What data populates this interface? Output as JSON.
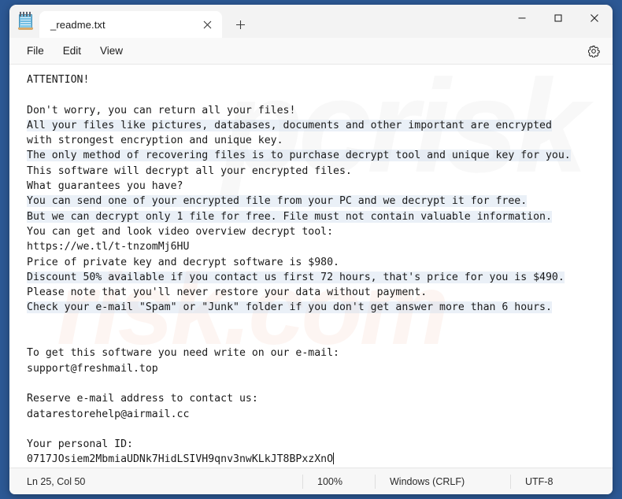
{
  "window": {
    "app_icon": "notepad-icon",
    "tab_title": "_readme.txt",
    "close_tab_icon": "close-icon",
    "new_tab_icon": "plus-icon",
    "minimize_icon": "minimize-icon",
    "maximize_icon": "maximize-icon",
    "close_icon": "close-icon",
    "background_color": "#2c5894"
  },
  "menubar": {
    "items": [
      {
        "label": "File"
      },
      {
        "label": "Edit"
      },
      {
        "label": "View"
      }
    ],
    "settings_icon": "gear-icon"
  },
  "watermark": {
    "top": "pcrisk",
    "bottom": "risk.com"
  },
  "document": {
    "lines": [
      "ATTENTION!",
      "",
      "Don't worry, you can return all your files!",
      "All your files like pictures, databases, documents and other important are encrypted",
      "with strongest encryption and unique key.",
      "The only method of recovering files is to purchase decrypt tool and unique key for you.",
      "This software will decrypt all your encrypted files.",
      "What guarantees you have?",
      "You can send one of your encrypted file from your PC and we decrypt it for free.",
      "But we can decrypt only 1 file for free. File must not contain valuable information.",
      "You can get and look video overview decrypt tool:",
      "https://we.tl/t-tnzomMj6HU",
      "Price of private key and decrypt software is $980.",
      "Discount 50% available if you contact us first 72 hours, that's price for you is $490.",
      "Please note that you'll never restore your data without payment.",
      "Check your e-mail \"Spam\" or \"Junk\" folder if you don't get answer more than 6 hours.",
      "",
      "",
      "To get this software you need write on our e-mail:",
      "support@freshmail.top",
      "",
      "Reserve e-mail address to contact us:",
      "datarestorehelp@airmail.cc",
      "",
      "Your personal ID:",
      "0717JOsiem2MbmiaUDNk7HidLSIVH9qnv3nwKLkJT8BPxzXnO"
    ]
  },
  "statusbar": {
    "position": "Ln 25, Col 50",
    "zoom": "100%",
    "line_ending": "Windows (CRLF)",
    "encoding": "UTF-8"
  }
}
